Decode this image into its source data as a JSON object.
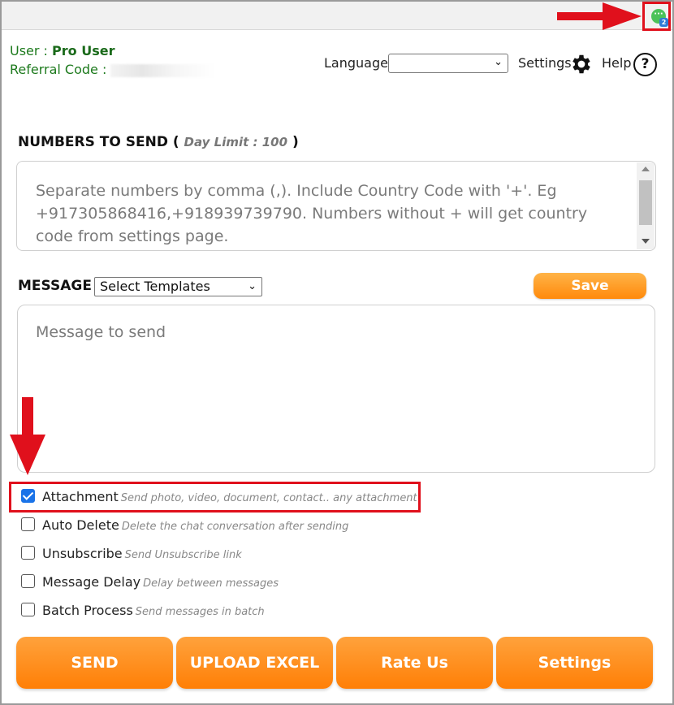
{
  "header": {
    "user_label": "User : ",
    "user_name": "Pro User",
    "referral_label": "Referral Code : ",
    "language_label": "Language",
    "language_value": "",
    "settings_label": "Settings",
    "help_label": "Help"
  },
  "numbers": {
    "title": "NUMBERS TO SEND (",
    "limit": "Day Limit : 100",
    "title_end": ")",
    "placeholder": "Separate numbers by comma (,). Include Country Code with '+'. Eg +917305868416,+918939739790. Numbers without + will get country code from settings page."
  },
  "message": {
    "title": "MESSAGE",
    "template_select": "Select Templates",
    "save_label": "Save",
    "placeholder": "Message to send"
  },
  "options": [
    {
      "label": "Attachment",
      "desc": "Send photo, video, document, contact.. any attachment",
      "checked": true
    },
    {
      "label": "Auto Delete",
      "desc": "Delete the chat conversation after sending",
      "checked": false
    },
    {
      "label": "Unsubscribe",
      "desc": "Send Unsubscribe link",
      "checked": false
    },
    {
      "label": "Message Delay",
      "desc": "Delay between messages",
      "checked": false
    },
    {
      "label": "Batch Process",
      "desc": "Send messages in batch",
      "checked": false
    }
  ],
  "actions": {
    "send": "SEND",
    "upload": "UPLOAD EXCEL",
    "rate": "Rate Us",
    "settings": "Settings"
  },
  "colors": {
    "accent_orange": "#ff8a0c",
    "highlight_red": "#e0101c",
    "user_green": "#1d7a1d",
    "checkbox_blue": "#1a73e8"
  },
  "icons": {
    "extension": "chat-extension-icon",
    "gear": "gear-icon",
    "help": "help-circle-icon"
  }
}
